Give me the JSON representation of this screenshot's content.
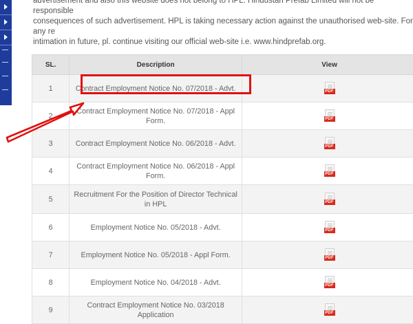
{
  "notice_text": "advertisement and also this website does not belong to HPL. Hindustan Prefab Limited will not be responsible\nconsequences of such advertisement. HPL is taking necessary action against the unauthorised web-site. For any re\nintimation in future, pl. continue visiting our official web-site i.e. www.hindprefab.org.",
  "table": {
    "headers": {
      "sl": "SL.",
      "description": "Description",
      "view": "View"
    },
    "rows": [
      {
        "sl": "1",
        "description": "Contract Employment Notice No. 07/2018 - Advt.",
        "view": "PDF"
      },
      {
        "sl": "2",
        "description": "Contract Employment Notice No. 07/2018 - Appl Form.",
        "view": "PDF"
      },
      {
        "sl": "3",
        "description": "Contract Employment Notice No. 06/2018 - Advt.",
        "view": "PDF"
      },
      {
        "sl": "4",
        "description": "Contract Employment Notice No. 06/2018 - Appl Form.",
        "view": "PDF"
      },
      {
        "sl": "5",
        "description": "Recruitment For the Position of Director Technical in HPL",
        "view": "PDF"
      },
      {
        "sl": "6",
        "description": "Employment Notice No. 05/2018 - Advt.",
        "view": "PDF"
      },
      {
        "sl": "7",
        "description": "Employment Notice No. 05/2018 - Appl Form.",
        "view": "PDF"
      },
      {
        "sl": "8",
        "description": "Employment Notice No. 04/2018 - Advt.",
        "view": "PDF"
      },
      {
        "sl": "9",
        "description": "Contract Employment Notice No. 03/2018 Application",
        "view": "PDF"
      }
    ]
  },
  "annotation": {
    "highlight_color": "#e01010",
    "arrow_color": "#e01010",
    "icon": "arrow-icon"
  },
  "colors": {
    "sidebar": "#1d3c9c",
    "pdf_red": "#d52b1e"
  }
}
